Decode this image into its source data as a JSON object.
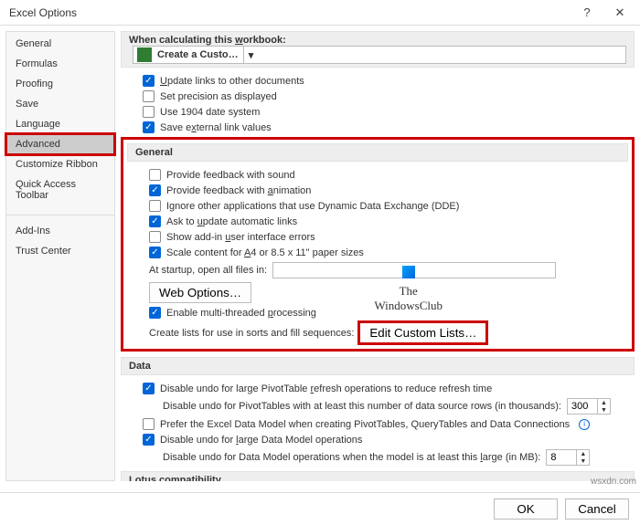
{
  "title": "Excel Options",
  "sidebar": {
    "items": [
      {
        "label": "General"
      },
      {
        "label": "Formulas"
      },
      {
        "label": "Proofing"
      },
      {
        "label": "Save"
      },
      {
        "label": "Language"
      },
      {
        "label": "Advanced"
      },
      {
        "label": "Customize Ribbon"
      },
      {
        "label": "Quick Access Toolbar"
      },
      {
        "label": "Add-Ins"
      },
      {
        "label": "Trust Center"
      }
    ]
  },
  "calc": {
    "label_pre": "When calculating this ",
    "label_u": "w",
    "label_post": "orkbook:",
    "combo": "Create a Custom Li…"
  },
  "opts": {
    "update_links": "pdate links to other documents",
    "set_precision": "Set precision as displayed",
    "use_1904": "Use 1904 date system",
    "save_ext": "Save external link values"
  },
  "general": {
    "header": "General",
    "sound": "Provide feedback with sound",
    "anim": "Provide feedback with animation",
    "dde": "Ignore other applications that use Dynamic Data Exchange (DDE)",
    "upd_auto": "pdate automatic links",
    "addin_err": "Show add-in user interface errors",
    "scale": "4 or 8.5 x 11\" paper sizes",
    "startup": "At startup, open all files in:",
    "web_opt": "Web Options…",
    "multi": "Enable multi-threaded processing",
    "lists_lbl": "Create lists for use in sorts and fill sequences:",
    "edit_lists": "Edit Custom Lists…"
  },
  "data": {
    "header": "Data",
    "undo_pivot": "efresh operations to reduce refresh time",
    "undo_rows_lbl": "Disable undo for PivotTables with at least this number of data source rows (in thousands):",
    "undo_rows_val": "300",
    "prefer_model": "Prefer the Excel Data Model when creating PivotTables, QueryTables and Data Connections",
    "undo_dm": "arge Data Model operations",
    "dm_size_lbl": "arge (in MB):",
    "dm_size_val": "8"
  },
  "lotus": {
    "header": "Lotus compatibility"
  },
  "footer": {
    "ok": "OK",
    "cancel": "Cancel"
  },
  "wm": {
    "line1": "The",
    "line2": "WindowsClub"
  },
  "src": "wsxdn.com"
}
